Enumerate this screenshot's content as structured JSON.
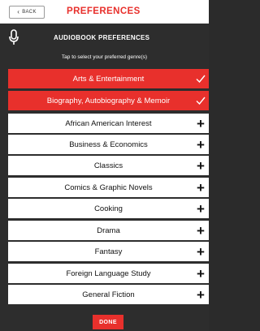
{
  "header": {
    "back_label": "BACK",
    "title": "PREFERENCES"
  },
  "panel": {
    "title": "AUDIOBOOK PREFERENCES",
    "hint": "Tap to select your preferred genre(s)"
  },
  "genres": [
    {
      "label": "Arts & Entertainment",
      "selected": true
    },
    {
      "label": "Biography, Autobiography & Memoir",
      "selected": true
    },
    {
      "label": "African American Interest",
      "selected": false
    },
    {
      "label": "Business & Economics",
      "selected": false
    },
    {
      "label": "Classics",
      "selected": false
    },
    {
      "label": "Comics & Graphic Novels",
      "selected": false
    },
    {
      "label": "Cooking",
      "selected": false
    },
    {
      "label": "Drama",
      "selected": false
    },
    {
      "label": "Fantasy",
      "selected": false
    },
    {
      "label": "Foreign Language Study",
      "selected": false
    },
    {
      "label": "General Fiction",
      "selected": false
    }
  ],
  "footer": {
    "done_label": "DONE"
  },
  "colors": {
    "accent": "#e8302c",
    "panel_bg": "#2d2d2d",
    "row_bg": "#ffffff"
  },
  "icons": {
    "mic": "microphone-icon",
    "selected": "checkmark-icon",
    "unselected": "plus-icon"
  }
}
